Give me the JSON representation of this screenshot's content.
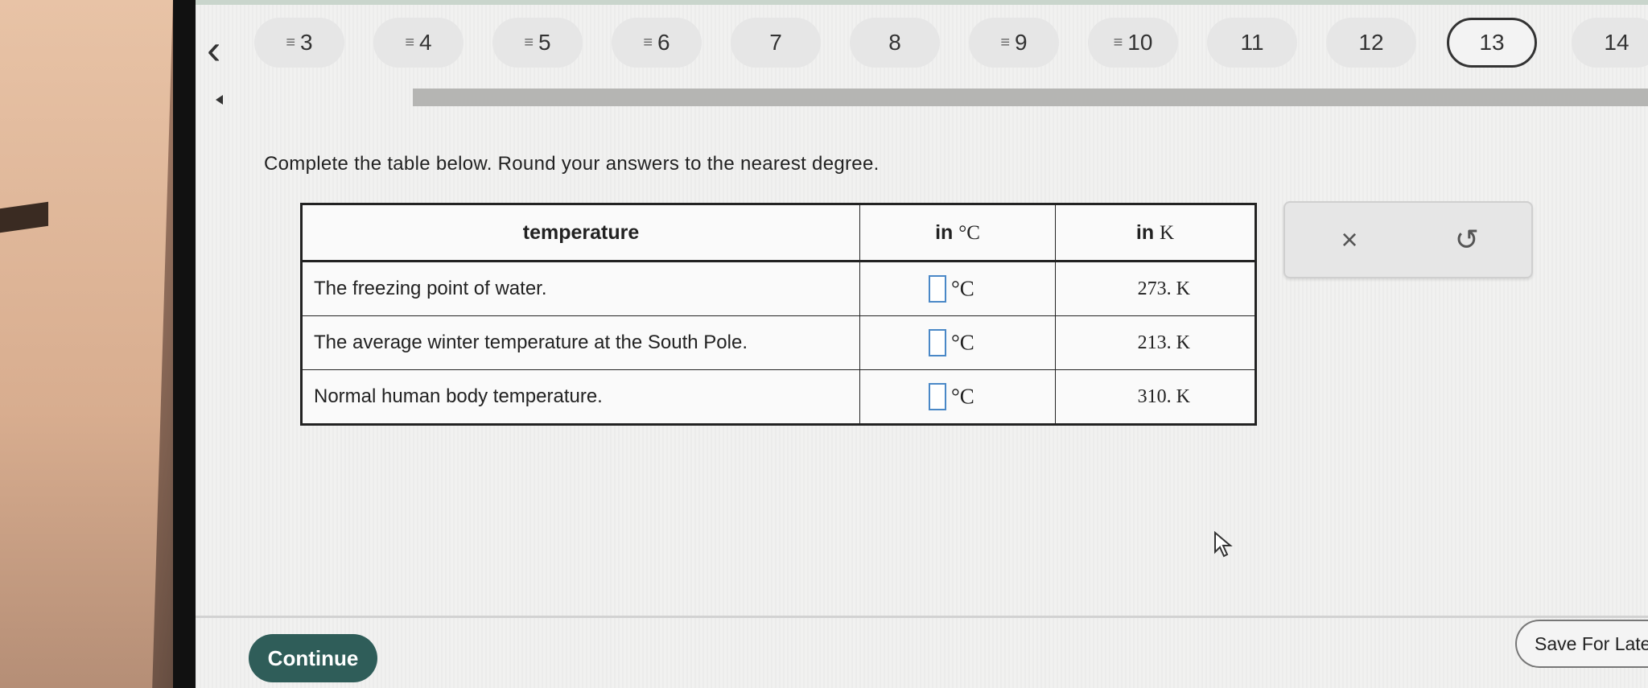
{
  "nav": {
    "questions": [
      {
        "label": "3",
        "icon": "list-icon"
      },
      {
        "label": "4",
        "icon": "list-icon"
      },
      {
        "label": "5",
        "icon": "list-icon"
      },
      {
        "label": "6",
        "icon": "list-icon"
      },
      {
        "label": "7",
        "icon": ""
      },
      {
        "label": "8",
        "icon": ""
      },
      {
        "label": "9",
        "icon": "list-icon"
      },
      {
        "label": "10",
        "icon": "list-icon"
      },
      {
        "label": "11",
        "icon": ""
      },
      {
        "label": "12",
        "icon": ""
      },
      {
        "label": "13",
        "icon": "",
        "current": true
      },
      {
        "label": "14",
        "icon": ""
      }
    ],
    "icon_glyph": "≡"
  },
  "question": {
    "prompt": "Complete the table below. Round your answers to the nearest degree."
  },
  "table": {
    "headers": {
      "col1": "temperature",
      "col2_prefix": "in",
      "col2_unit": "°C",
      "col3_prefix": "in",
      "col3_unit": "K"
    },
    "rows": [
      {
        "description": "The freezing point of water.",
        "celsius_value": "",
        "celsius_unit": "°C",
        "kelvin": "273. K"
      },
      {
        "description": "The average winter temperature at the South Pole.",
        "celsius_value": "",
        "celsius_unit": "°C",
        "kelvin": "213. K"
      },
      {
        "description": "Normal human body temperature.",
        "celsius_value": "",
        "celsius_unit": "°C",
        "kelvin": "310. K"
      }
    ]
  },
  "tools": {
    "clear": "×",
    "undo": "↺"
  },
  "footer": {
    "continue_label": "Continue",
    "save_label": "Save For Later"
  },
  "colors": {
    "continue_bg": "#2f5d59",
    "input_border": "#4a88c7"
  }
}
